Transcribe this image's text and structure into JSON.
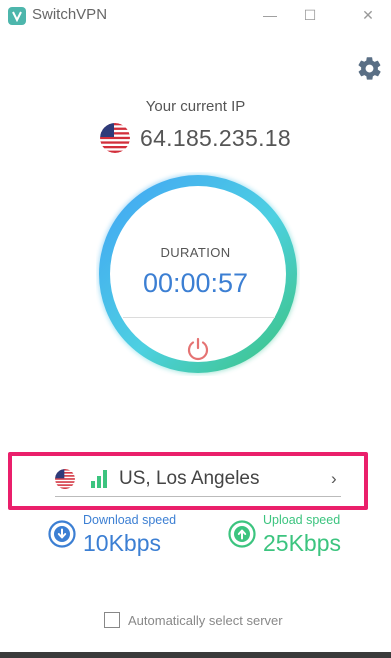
{
  "window": {
    "title": "SwitchVPN",
    "minimize_glyph": "—",
    "maximize_glyph": "☐",
    "close_glyph": "✕"
  },
  "ip": {
    "label": "Your current IP",
    "address": "64.185.235.18",
    "flag": "us-flag-icon"
  },
  "connection": {
    "duration_label": "DURATION",
    "duration_value": "00:00:57"
  },
  "server": {
    "name": "US, Los Angeles",
    "chevron": "›",
    "signal_bars": 3,
    "highlight_color": "#ea1f6b"
  },
  "speeds": {
    "download_label": "Download speed",
    "download_value": "10Kbps",
    "upload_label": "Upload speed",
    "upload_value": "25Kbps"
  },
  "auto_select": {
    "label": "Automatically select server",
    "checked": false
  },
  "colors": {
    "accent_blue": "#3c7fd3",
    "accent_green": "#3cc47f",
    "power_red": "#e57373",
    "ring_gradient": [
      "#4fc3f7",
      "#3cc47f"
    ]
  }
}
